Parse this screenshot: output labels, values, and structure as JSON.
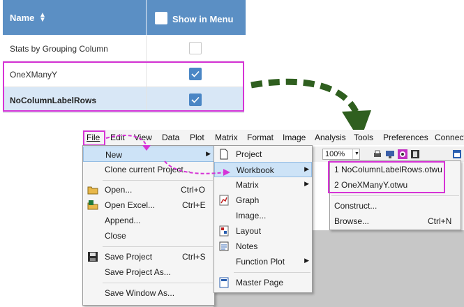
{
  "table": {
    "header": {
      "name": "Name",
      "sort_icon": "sort-arrows-icon",
      "show_in_menu": "Show in Menu"
    },
    "rows": [
      {
        "name": "Stats by Grouping Column",
        "checked": false
      },
      {
        "name": "OneXManyY",
        "checked": true
      },
      {
        "name": "NoColumnLabelRows",
        "checked": true,
        "selected": true
      }
    ]
  },
  "menubar": {
    "items": [
      "File",
      "Edit",
      "View",
      "Data",
      "Plot",
      "Matrix",
      "Format",
      "Image",
      "Analysis",
      "Tools",
      "Preferences",
      "Connectivity"
    ]
  },
  "toolbar": {
    "zoom": "100%"
  },
  "file_menu": {
    "items": [
      {
        "label": "New",
        "shortcut": "",
        "submenu": true
      },
      {
        "label": "Clone current Project...",
        "shortcut": ""
      },
      {
        "label": "Open...",
        "shortcut": "Ctrl+O",
        "icon": "open-folder-icon"
      },
      {
        "label": "Open Excel...",
        "shortcut": "Ctrl+E",
        "icon": "open-excel-icon"
      },
      {
        "label": "Append...",
        "shortcut": ""
      },
      {
        "label": "Close",
        "shortcut": ""
      },
      {
        "label": "Save Project",
        "shortcut": "Ctrl+S",
        "icon": "save-icon"
      },
      {
        "label": "Save Project As...",
        "shortcut": ""
      },
      {
        "label": "Save Window As...",
        "shortcut": ""
      }
    ]
  },
  "new_menu": {
    "items": [
      {
        "label": "Project",
        "submenu": false,
        "icon": "project-icon"
      },
      {
        "label": "Workbook",
        "submenu": true
      },
      {
        "label": "Matrix",
        "submenu": true
      },
      {
        "label": "Graph",
        "submenu": false,
        "icon": "graph-icon"
      },
      {
        "label": "Image...",
        "submenu": false
      },
      {
        "label": "Layout",
        "submenu": false,
        "icon": "layout-icon"
      },
      {
        "label": "Notes",
        "submenu": false,
        "icon": "notes-icon"
      },
      {
        "label": "Function Plot",
        "submenu": true
      },
      {
        "label": "Master Page",
        "submenu": false,
        "icon": "master-page-icon"
      }
    ]
  },
  "workbook_menu": {
    "items": [
      {
        "label": "1 NoColumnLabelRows.otwu"
      },
      {
        "label": "2 OneXManyY.otwu"
      },
      {
        "label": "Construct..."
      },
      {
        "label": "Browse...",
        "shortcut": "Ctrl+N"
      }
    ]
  },
  "colors": {
    "header_bg": "#5b8fc4",
    "highlight": "#d633d6",
    "arrow": "#2f5f1f",
    "selected_row": "#d8e7f6"
  }
}
